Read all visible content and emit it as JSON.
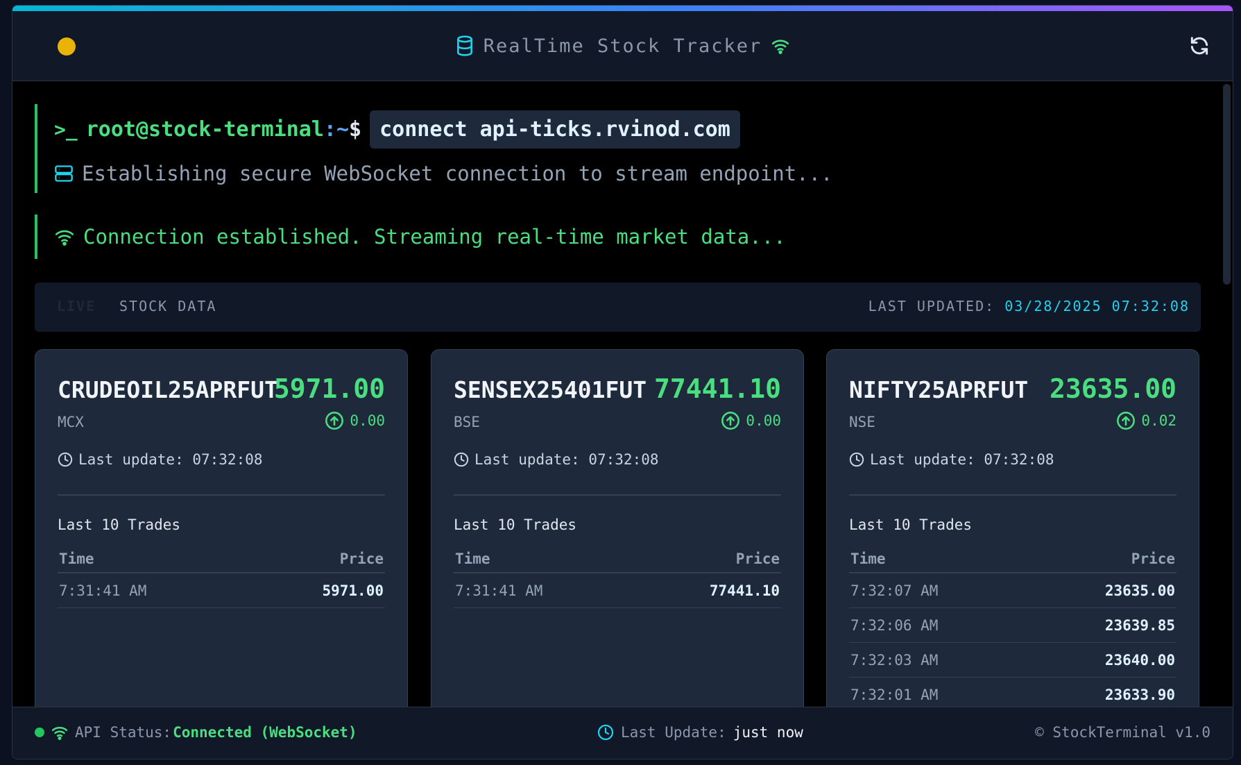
{
  "window": {
    "title": "RealTime Stock Tracker",
    "status_dot_color": "#eab308",
    "accent_gradient": [
      "#06b6d4",
      "#3b82f6",
      "#a855f7"
    ]
  },
  "terminal": {
    "prompt_symbol": ">_",
    "user_host": "root@stock-terminal",
    "path": ":~",
    "dollar": "$",
    "command": "connect api-ticks.rvinod.com",
    "info": "Establishing secure WebSocket connection to stream endpoint...",
    "connected": "Connection established. Streaming real-time market data..."
  },
  "live_bar": {
    "badge": "LIVE",
    "label": "STOCK DATA",
    "last_updated_label": "LAST UPDATED:",
    "last_updated_value": "03/28/2025 07:32:08"
  },
  "cards": [
    {
      "symbol": "CRUDEOIL25APRFUT",
      "price": "5971.00",
      "exchange": "MCX",
      "change": "0.00",
      "last_update": "Last update: 07:32:08",
      "trades_title": "Last 10 Trades",
      "col_time": "Time",
      "col_price": "Price",
      "trades": [
        {
          "time": "7:31:41 AM",
          "price": "5971.00"
        }
      ]
    },
    {
      "symbol": "SENSEX25401FUT",
      "price": "77441.10",
      "exchange": "BSE",
      "change": "0.00",
      "last_update": "Last update: 07:32:08",
      "trades_title": "Last 10 Trades",
      "col_time": "Time",
      "col_price": "Price",
      "trades": [
        {
          "time": "7:31:41 AM",
          "price": "77441.10"
        }
      ]
    },
    {
      "symbol": "NIFTY25APRFUT",
      "price": "23635.00",
      "exchange": "NSE",
      "change": "0.02",
      "last_update": "Last update: 07:32:08",
      "trades_title": "Last 10 Trades",
      "col_time": "Time",
      "col_price": "Price",
      "trades": [
        {
          "time": "7:32:07 AM",
          "price": "23635.00"
        },
        {
          "time": "7:32:06 AM",
          "price": "23639.85"
        },
        {
          "time": "7:32:03 AM",
          "price": "23640.00"
        },
        {
          "time": "7:32:01 AM",
          "price": "23633.90"
        }
      ]
    }
  ],
  "footer": {
    "api_label": "API Status:",
    "api_value": "Connected (WebSocket)",
    "update_label": "Last Update:",
    "update_value": "just now",
    "copyright": "© StockTerminal v1.0"
  }
}
